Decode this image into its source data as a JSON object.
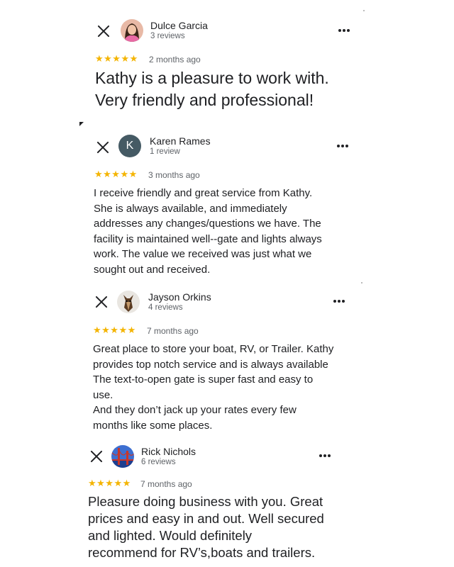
{
  "reviews": [
    {
      "name": "Dulce Garcia",
      "count": "3 reviews",
      "stars": "★★★★★",
      "rating": 5,
      "date": "2 months ago",
      "text": "Kathy is a pleasure to work with.\nVery friendly and professional!",
      "avatar_icon": "user-photo-icon"
    },
    {
      "name": "Karen Rames",
      "count": "1 review",
      "stars": "★★★★★",
      "rating": 5,
      "date": "3 months ago",
      "initial": "K",
      "text": "I receive friendly and great service from Kathy.\nShe is always available, and immediately\naddresses any changes/questions we have.  The\nfacility is maintained well--gate and lights always\nwork.  The value we received was just what we\nsought out and received.",
      "avatar_color": "#455a64"
    },
    {
      "name": "Jayson Orkins",
      "count": "4 reviews",
      "stars": "★★★★★",
      "rating": 5,
      "date": "7 months ago",
      "text": "Great place to store your boat, RV, or Trailer. Kathy\nprovides top notch service and is always available\nThe text-to-open gate is super fast and easy to\nuse.\nAnd they don’t jack up your rates every few\nmonths like some places.",
      "avatar_icon": "dog-photo-icon"
    },
    {
      "name": "Rick Nichols",
      "count": "6 reviews",
      "stars": "★★★★★",
      "rating": 5,
      "date": "7 months ago",
      "text": "Pleasure doing business with you. Great\nprices and easy in and out. Well secured\nand lighted. Would definitely\nrecommend for RV’s,boats and trailers.",
      "avatar_icon": "bridge-photo-icon"
    }
  ],
  "colors": {
    "star": "#f4b400",
    "text": "#202124",
    "secondary": "#5f6368"
  }
}
